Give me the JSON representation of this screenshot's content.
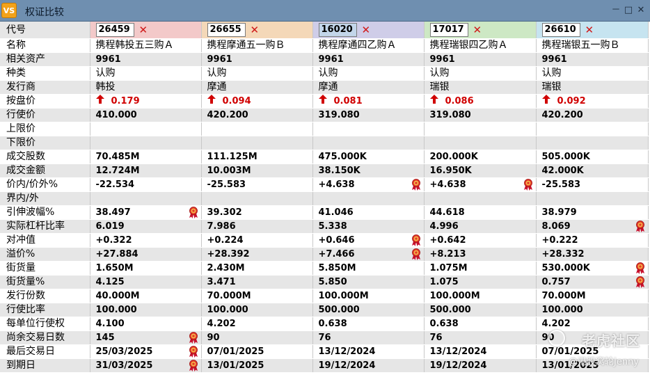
{
  "window": {
    "icon_text": "VS",
    "title": "权证比较",
    "minimize": "－",
    "restore": "□",
    "close": "✕"
  },
  "columns": [
    {
      "code": "26459",
      "selected": false,
      "header_color": "#f3c9c9"
    },
    {
      "code": "26655",
      "selected": false,
      "header_color": "#f4d8b8"
    },
    {
      "code": "16020",
      "selected": true,
      "header_color": "#cfcde8"
    },
    {
      "code": "17017",
      "selected": false,
      "header_color": "#cde8c4"
    },
    {
      "code": "26610",
      "selected": false,
      "header_color": "#c6e4f0"
    }
  ],
  "remove_symbol": "✕",
  "up_arrow": "🡅",
  "rows": [
    {
      "label": "名称",
      "bold": false,
      "cells": [
        {
          "v": "携程韩投五三购Ａ"
        },
        {
          "v": "携程摩通五一购Ｂ"
        },
        {
          "v": "携程摩通四乙购Ａ"
        },
        {
          "v": "携程瑞银四乙购Ａ"
        },
        {
          "v": "携程瑞银五一购Ｂ"
        }
      ]
    },
    {
      "label": "相关资产",
      "bold": true,
      "cells": [
        {
          "v": "9961"
        },
        {
          "v": "9961"
        },
        {
          "v": "9961"
        },
        {
          "v": "9961"
        },
        {
          "v": "9961"
        }
      ]
    },
    {
      "label": "种类",
      "bold": false,
      "cells": [
        {
          "v": "认购"
        },
        {
          "v": "认购"
        },
        {
          "v": "认购"
        },
        {
          "v": "认购"
        },
        {
          "v": "认购"
        }
      ]
    },
    {
      "label": "发行商",
      "bold": false,
      "cells": [
        {
          "v": "韩投"
        },
        {
          "v": "摩通"
        },
        {
          "v": "摩通"
        },
        {
          "v": "瑞银"
        },
        {
          "v": "瑞银"
        }
      ]
    },
    {
      "label": "按盘价",
      "bold": true,
      "price": true,
      "cells": [
        {
          "v": "0.179"
        },
        {
          "v": "0.094"
        },
        {
          "v": "0.081"
        },
        {
          "v": "0.086"
        },
        {
          "v": "0.092"
        }
      ]
    },
    {
      "label": "行使价",
      "bold": true,
      "cells": [
        {
          "v": "410.000"
        },
        {
          "v": "420.200"
        },
        {
          "v": "319.080"
        },
        {
          "v": "319.080"
        },
        {
          "v": "420.200"
        }
      ]
    },
    {
      "label": "上限价",
      "bold": true,
      "cells": [
        {
          "v": ""
        },
        {
          "v": ""
        },
        {
          "v": ""
        },
        {
          "v": ""
        },
        {
          "v": ""
        }
      ]
    },
    {
      "label": "下限价",
      "bold": true,
      "cells": [
        {
          "v": ""
        },
        {
          "v": ""
        },
        {
          "v": ""
        },
        {
          "v": ""
        },
        {
          "v": ""
        }
      ]
    },
    {
      "label": "成交股数",
      "bold": true,
      "cells": [
        {
          "v": "70.485M"
        },
        {
          "v": "111.125M"
        },
        {
          "v": "475.000K"
        },
        {
          "v": "200.000K"
        },
        {
          "v": "505.000K"
        }
      ]
    },
    {
      "label": "成交金额",
      "bold": true,
      "cells": [
        {
          "v": "12.724M"
        },
        {
          "v": "10.003M"
        },
        {
          "v": "38.150K"
        },
        {
          "v": "16.950K"
        },
        {
          "v": "42.000K"
        }
      ]
    },
    {
      "label": "价内/价外%",
      "bold": true,
      "cells": [
        {
          "v": "-22.534"
        },
        {
          "v": "-25.583"
        },
        {
          "v": "+4.638",
          "medal": true
        },
        {
          "v": "+4.638",
          "medal": true
        },
        {
          "v": "-25.583"
        }
      ]
    },
    {
      "label": "界内/外",
      "bold": true,
      "cells": [
        {
          "v": ""
        },
        {
          "v": ""
        },
        {
          "v": ""
        },
        {
          "v": ""
        },
        {
          "v": ""
        }
      ]
    },
    {
      "label": "引伸波幅%",
      "bold": true,
      "cells": [
        {
          "v": "38.497",
          "medal": true
        },
        {
          "v": "39.302"
        },
        {
          "v": "41.046"
        },
        {
          "v": "44.618"
        },
        {
          "v": "38.979"
        }
      ]
    },
    {
      "label": "实际杠杆比率",
      "bold": true,
      "cells": [
        {
          "v": "6.019"
        },
        {
          "v": "7.986"
        },
        {
          "v": "5.338"
        },
        {
          "v": "4.996"
        },
        {
          "v": "8.069",
          "medal": true
        }
      ]
    },
    {
      "label": "对冲值",
      "bold": true,
      "cells": [
        {
          "v": "+0.322"
        },
        {
          "v": "+0.224"
        },
        {
          "v": "+0.646",
          "medal": true
        },
        {
          "v": "+0.642"
        },
        {
          "v": "+0.222"
        }
      ]
    },
    {
      "label": "溢价%",
      "bold": true,
      "cells": [
        {
          "v": "+27.884"
        },
        {
          "v": "+28.392"
        },
        {
          "v": "+7.466",
          "medal": true
        },
        {
          "v": "+8.213"
        },
        {
          "v": "+28.332"
        }
      ]
    },
    {
      "label": "街货量",
      "bold": true,
      "cells": [
        {
          "v": "1.650M"
        },
        {
          "v": "2.430M"
        },
        {
          "v": "5.850M"
        },
        {
          "v": "1.075M"
        },
        {
          "v": "530.000K",
          "medal": true
        }
      ]
    },
    {
      "label": "街货量%",
      "bold": true,
      "cells": [
        {
          "v": "4.125"
        },
        {
          "v": "3.471"
        },
        {
          "v": "5.850"
        },
        {
          "v": "1.075"
        },
        {
          "v": "0.757",
          "medal": true
        }
      ]
    },
    {
      "label": "发行份数",
      "bold": true,
      "cells": [
        {
          "v": "40.000M"
        },
        {
          "v": "70.000M"
        },
        {
          "v": "100.000M"
        },
        {
          "v": "100.000M"
        },
        {
          "v": "70.000M"
        }
      ]
    },
    {
      "label": "行使比率",
      "bold": true,
      "cells": [
        {
          "v": "100.000"
        },
        {
          "v": "100.000"
        },
        {
          "v": "500.000"
        },
        {
          "v": "500.000"
        },
        {
          "v": "100.000"
        }
      ]
    },
    {
      "label": "每单位行使权",
      "bold": true,
      "cells": [
        {
          "v": "4.100"
        },
        {
          "v": "4.202"
        },
        {
          "v": "0.638"
        },
        {
          "v": "0.638"
        },
        {
          "v": "4.202"
        }
      ]
    },
    {
      "label": "尚余交易日数",
      "bold": true,
      "cells": [
        {
          "v": "145",
          "medal": true
        },
        {
          "v": "90"
        },
        {
          "v": "76"
        },
        {
          "v": "76"
        },
        {
          "v": "90"
        }
      ]
    },
    {
      "label": "最后交易日",
      "bold": true,
      "cells": [
        {
          "v": "25/03/2025",
          "medal": true
        },
        {
          "v": "07/01/2025"
        },
        {
          "v": "13/12/2024"
        },
        {
          "v": "13/12/2024"
        },
        {
          "v": "07/01/2025"
        }
      ]
    },
    {
      "label": "到期日",
      "bold": true,
      "cells": [
        {
          "v": "31/03/2025",
          "medal": true
        },
        {
          "v": "13/01/2025"
        },
        {
          "v": "19/12/2024"
        },
        {
          "v": "19/12/2024"
        },
        {
          "v": "13/01/2025"
        }
      ]
    }
  ],
  "header_label": "代号",
  "watermark": {
    "brand": "老虎社区",
    "author": "@港股窝轮Jenny"
  },
  "colors": {
    "price_red": "#d00000",
    "titlebar": "#6f8fb0",
    "stripe": "#e6e6e6"
  }
}
